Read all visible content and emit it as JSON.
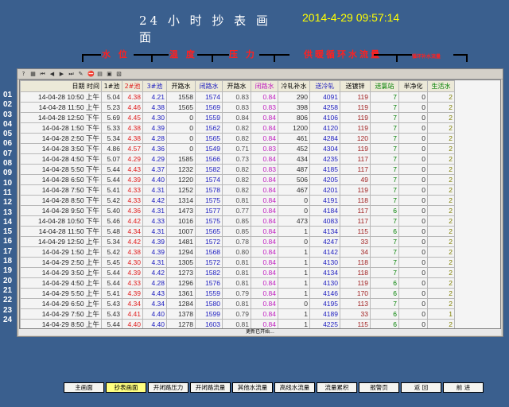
{
  "title": "24 小 时 抄 表 画 面",
  "datetime": "2014-4-29 09:57:14",
  "groups": [
    {
      "label": "水 位",
      "color": "#ff2020"
    },
    {
      "label": "温 度",
      "color": "#ff2020"
    },
    {
      "label": "压 力",
      "color": "#ff2020"
    },
    {
      "label": "供暖循环水流量",
      "color": "#ff2020"
    },
    {
      "label": "循环补水流量",
      "color": "#ff2020"
    }
  ],
  "columns": [
    {
      "label": "日期",
      "color": "#000000"
    },
    {
      "label": "时间",
      "color": "#000000"
    },
    {
      "label": "1#池",
      "color": "#000000"
    },
    {
      "label": "2#池",
      "color": "#e02020"
    },
    {
      "label": "3#池",
      "color": "#2020c0"
    },
    {
      "label": "开路水",
      "color": "#000000"
    },
    {
      "label": "闭路水",
      "color": "#2020c0"
    },
    {
      "label": "开路水",
      "color": "#000000"
    },
    {
      "label": "闭路水",
      "color": "#c020c0"
    },
    {
      "label": "冷轧补水",
      "color": "#000000"
    },
    {
      "label": "送冷轧",
      "color": "#2020c0"
    },
    {
      "label": "送镀锌",
      "color": "#000000"
    },
    {
      "label": "送氯站",
      "color": "#008000"
    },
    {
      "label": "半净化",
      "color": "#000000"
    },
    {
      "label": "生活水",
      "color": "#008000"
    }
  ],
  "col_colors": [
    "#222222",
    "#222222",
    "#303030",
    "#e02020",
    "#2020c0",
    "#303030",
    "#2020c0",
    "#505050",
    "#c020c0",
    "#303030",
    "#2020c0",
    "#a02020",
    "#008000",
    "#303030",
    "#808000"
  ],
  "rows": [
    [
      "14-04-28 10:50 上午",
      "5.04",
      "4.38",
      "4.21",
      "1558",
      "1574",
      "0.83",
      "0.84",
      "290",
      "4091",
      "119",
      "7",
      "0",
      "2"
    ],
    [
      "14-04-28 11:50 上午",
      "5.23",
      "4.46",
      "4.38",
      "1565",
      "1569",
      "0.83",
      "0.83",
      "398",
      "4258",
      "119",
      "7",
      "0",
      "2"
    ],
    [
      "14-04-28 12:50 下午",
      "5.69",
      "4.45",
      "4.30",
      "0",
      "1559",
      "0.84",
      "0.84",
      "806",
      "4106",
      "119",
      "7",
      "0",
      "2"
    ],
    [
      "14-04-28 1:50 下午",
      "5.33",
      "4.38",
      "4.39",
      "0",
      "1562",
      "0.82",
      "0.84",
      "1200",
      "4120",
      "119",
      "7",
      "0",
      "2"
    ],
    [
      "14-04-28 2:50 下午",
      "5.34",
      "4.38",
      "4.28",
      "0",
      "1565",
      "0.82",
      "0.84",
      "461",
      "4284",
      "120",
      "7",
      "0",
      "2"
    ],
    [
      "14-04-28 3:50 下午",
      "4.86",
      "4.57",
      "4.36",
      "0",
      "1549",
      "0.71",
      "0.83",
      "452",
      "4304",
      "119",
      "7",
      "0",
      "2"
    ],
    [
      "14-04-28 4:50 下午",
      "5.07",
      "4.29",
      "4.29",
      "1585",
      "1566",
      "0.73",
      "0.84",
      "434",
      "4235",
      "117",
      "7",
      "0",
      "2"
    ],
    [
      "14-04-28 5:50 下午",
      "5.44",
      "4.43",
      "4.37",
      "1232",
      "1582",
      "0.82",
      "0.83",
      "487",
      "4185",
      "117",
      "7",
      "0",
      "2"
    ],
    [
      "14-04-28 6:50 下午",
      "5.44",
      "4.39",
      "4.40",
      "1220",
      "1574",
      "0.82",
      "0.84",
      "506",
      "4205",
      "49",
      "7",
      "0",
      "2"
    ],
    [
      "14-04-28 7:50 下午",
      "5.41",
      "4.33",
      "4.31",
      "1252",
      "1578",
      "0.82",
      "0.84",
      "467",
      "4201",
      "119",
      "7",
      "0",
      "2"
    ],
    [
      "14-04-28 8:50 下午",
      "5.42",
      "4.33",
      "4.42",
      "1314",
      "1575",
      "0.81",
      "0.84",
      "0",
      "4191",
      "118",
      "7",
      "0",
      "2"
    ],
    [
      "14-04-28 9:50 下午",
      "5.40",
      "4.36",
      "4.31",
      "1473",
      "1577",
      "0.77",
      "0.84",
      "0",
      "4184",
      "117",
      "6",
      "0",
      "2"
    ],
    [
      "14-04-28 10:50 下午",
      "5.46",
      "4.42",
      "4.33",
      "1016",
      "1575",
      "0.85",
      "0.84",
      "473",
      "4083",
      "117",
      "7",
      "0",
      "2"
    ],
    [
      "14-04-28 11:50 下午",
      "5.48",
      "4.34",
      "4.31",
      "1007",
      "1565",
      "0.85",
      "0.84",
      "1",
      "4134",
      "115",
      "6",
      "0",
      "2"
    ],
    [
      "14-04-29 12:50 上午",
      "5.34",
      "4.42",
      "4.39",
      "1481",
      "1572",
      "0.78",
      "0.84",
      "0",
      "4247",
      "33",
      "7",
      "0",
      "2"
    ],
    [
      "14-04-29 1:50 上午",
      "5.42",
      "4.38",
      "4.39",
      "1294",
      "1568",
      "0.80",
      "0.84",
      "1",
      "4142",
      "34",
      "7",
      "0",
      "2"
    ],
    [
      "14-04-29 2:50 上午",
      "5.45",
      "4.30",
      "4.31",
      "1305",
      "1572",
      "0.81",
      "0.84",
      "1",
      "4130",
      "118",
      "7",
      "0",
      "2"
    ],
    [
      "14-04-29 3:50 上午",
      "5.44",
      "4.39",
      "4.42",
      "1273",
      "1582",
      "0.81",
      "0.84",
      "1",
      "4134",
      "118",
      "7",
      "0",
      "2"
    ],
    [
      "14-04-29 4:50 上午",
      "5.44",
      "4.33",
      "4.28",
      "1296",
      "1576",
      "0.81",
      "0.84",
      "1",
      "4130",
      "119",
      "6",
      "0",
      "2"
    ],
    [
      "14-04-29 5:50 上午",
      "5.41",
      "4.39",
      "4.43",
      "1361",
      "1559",
      "0.79",
      "0.84",
      "1",
      "4146",
      "170",
      "6",
      "0",
      "2"
    ],
    [
      "14-04-29 6:50 上午",
      "5.43",
      "4.34",
      "4.34",
      "1284",
      "1580",
      "0.81",
      "0.84",
      "0",
      "4195",
      "113",
      "7",
      "0",
      "2"
    ],
    [
      "14-04-29 7:50 上午",
      "5.43",
      "4.41",
      "4.40",
      "1378",
      "1599",
      "0.79",
      "0.84",
      "1",
      "4189",
      "33",
      "6",
      "0",
      "1"
    ],
    [
      "14-04-29 8:50 上午",
      "5.44",
      "4.40",
      "4.40",
      "1278",
      "1603",
      "0.81",
      "0.84",
      "1",
      "4225",
      "115",
      "6",
      "0",
      "2"
    ],
    [
      "14-04-29 9:50 上午",
      "5.35",
      "4.22",
      "4.43",
      "1332",
      "1593",
      "0.80",
      "0.84",
      "1",
      "4255",
      "118",
      "7",
      "0",
      "2"
    ]
  ],
  "row_numbers": [
    "01",
    "02",
    "03",
    "04",
    "05",
    "06",
    "07",
    "08",
    "09",
    "10",
    "11",
    "12",
    "13",
    "14",
    "15",
    "16",
    "17",
    "18",
    "19",
    "20",
    "21",
    "22",
    "23",
    "24"
  ],
  "status_text": "更新已开始...",
  "nav_buttons": [
    "主画面",
    "抄表画面",
    "开闭路压力",
    "开闭路流量",
    "其他水流量",
    "高线水流量",
    "流量累积",
    "报警页",
    "返 回",
    "前 进"
  ],
  "active_button": "抄表画面"
}
